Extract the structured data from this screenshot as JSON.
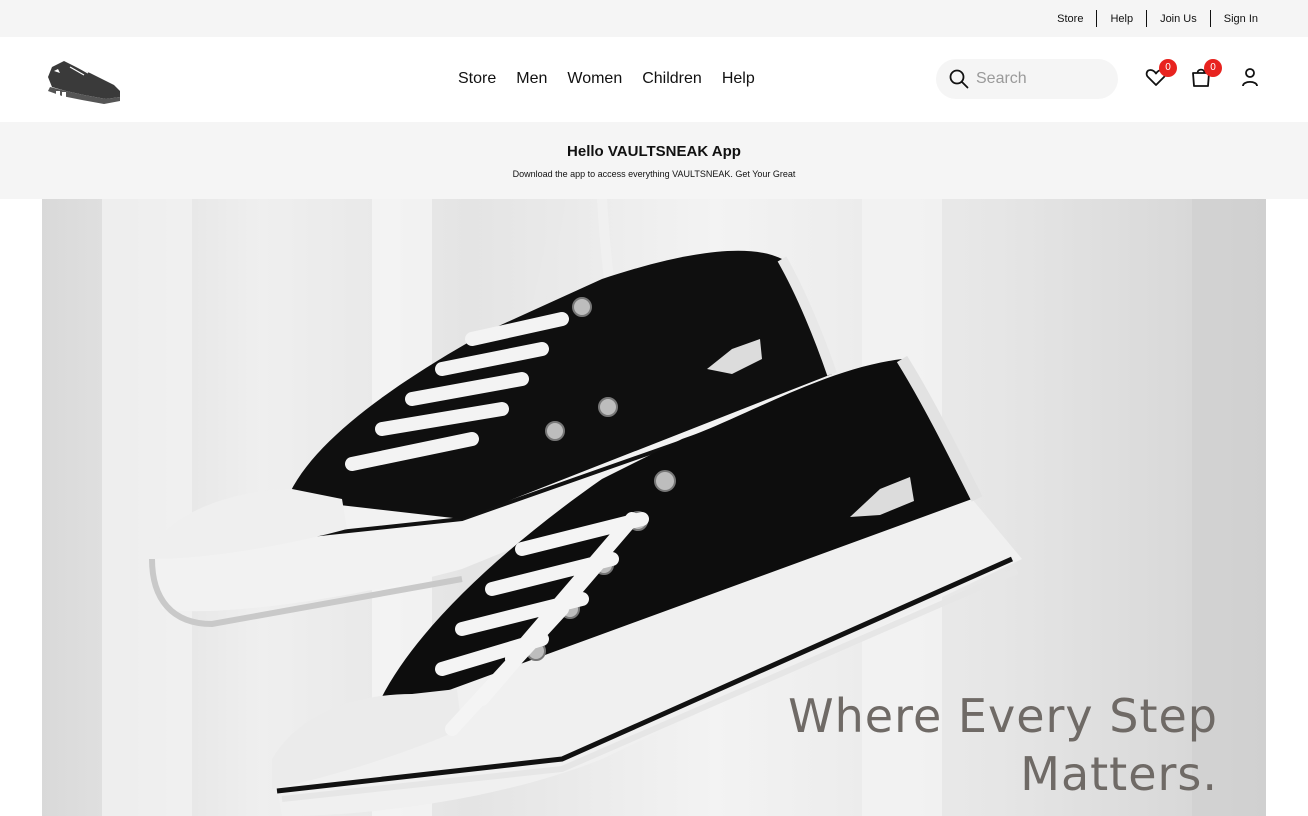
{
  "utility_nav": {
    "links": [
      "Store",
      "Help",
      "Join Us",
      "Sign In"
    ]
  },
  "logo": {
    "icon": "sneaker-logo-icon"
  },
  "main_nav": {
    "links": [
      "Store",
      "Men",
      "Women",
      "Children",
      "Help"
    ]
  },
  "search": {
    "placeholder": "Search",
    "icon": "search-icon"
  },
  "favorites": {
    "icon": "heart-icon",
    "count": "0"
  },
  "cart": {
    "icon": "shopping-bag-icon",
    "count": "0"
  },
  "account": {
    "icon": "user-icon"
  },
  "promo": {
    "title": "Hello VAULTSNEAK App",
    "subtitle": "Download the app to access everything VAULTSNEAK. Get Your Great"
  },
  "hero": {
    "image": "hanging-black-canvas-sneakers",
    "tagline_line1": "Where Every Step",
    "tagline_line2": "Matters."
  },
  "colors": {
    "badge": "#e8231f",
    "bar_background": "#f5f5f5",
    "tagline": "#6f6a66"
  }
}
